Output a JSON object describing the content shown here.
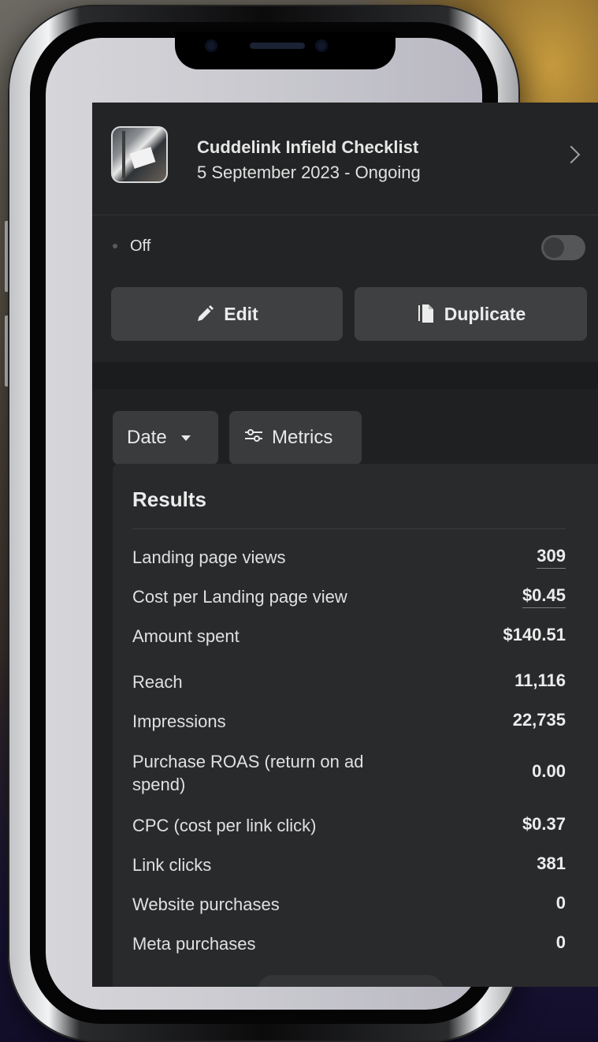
{
  "campaign": {
    "name": "Cuddelink Infield Checklist",
    "dates": "5 September 2023 -  Ongoing"
  },
  "status": {
    "label": "Off",
    "toggle_on": false
  },
  "actions": {
    "edit_label": "Edit",
    "duplicate_label": "Duplicate"
  },
  "filters": {
    "date_label": "Date",
    "metrics_label": "Metrics"
  },
  "results": {
    "title": "Results",
    "rows": [
      {
        "label": "Landing page views",
        "value": "309"
      },
      {
        "label": "Cost per Landing page view",
        "value": "$0.45"
      },
      {
        "label": "Amount spent",
        "value": "$140.51"
      },
      {
        "label": "Reach",
        "value": "11,116"
      },
      {
        "label": "Impressions",
        "value": "22,735"
      },
      {
        "label": "Purchase ROAS (return on ad spend)",
        "value": "0.00"
      },
      {
        "label": "CPC (cost per link click)",
        "value": "$0.37"
      },
      {
        "label": "Link clicks",
        "value": "381"
      },
      {
        "label": "Website purchases",
        "value": "0"
      },
      {
        "label": "Meta purchases",
        "value": "0"
      }
    ]
  },
  "icons": {
    "edit": "pencil-icon",
    "duplicate": "duplicate-icon",
    "date": "caret-down-icon",
    "metrics": "sliders-icon",
    "header": "chevron-right-icon"
  }
}
